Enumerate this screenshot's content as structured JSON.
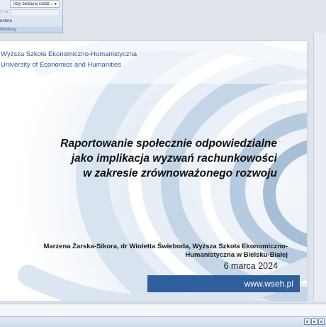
{
  "ribbon": {
    "combo_value": "Użyj bieżącej rozdz...",
    "combo_label": "y na:",
    "item1": "entera",
    "item2": "Monitory"
  },
  "slide": {
    "school_pl": "Wyższa Szkoła Ekonomiczno-Humanistyczna",
    "school_en": "University of Economics and Humanities",
    "title_lines": [
      "Raportowanie społecznie odpowiedzialne",
      "jako implikacja wyzwań rachunkowości",
      "w zakresie zrównoważonego rozwoju"
    ],
    "author_lines": [
      "Marzena Żarska-Sikora, dr Wioletta Świeboda, Wyższa Szkoła Ekonomiczno-",
      "Humanistyczna w Bielsku-Białej"
    ],
    "date": "6 marca 2024",
    "url": "www.wseh.pl"
  },
  "colors": {
    "accent_blue": "#2e5f9b",
    "school_text": "#2f5a93"
  },
  "statusbar": {
    "view_buttons": [
      "normal-view-icon",
      "slide-sorter-icon",
      "slideshow-icon"
    ]
  }
}
